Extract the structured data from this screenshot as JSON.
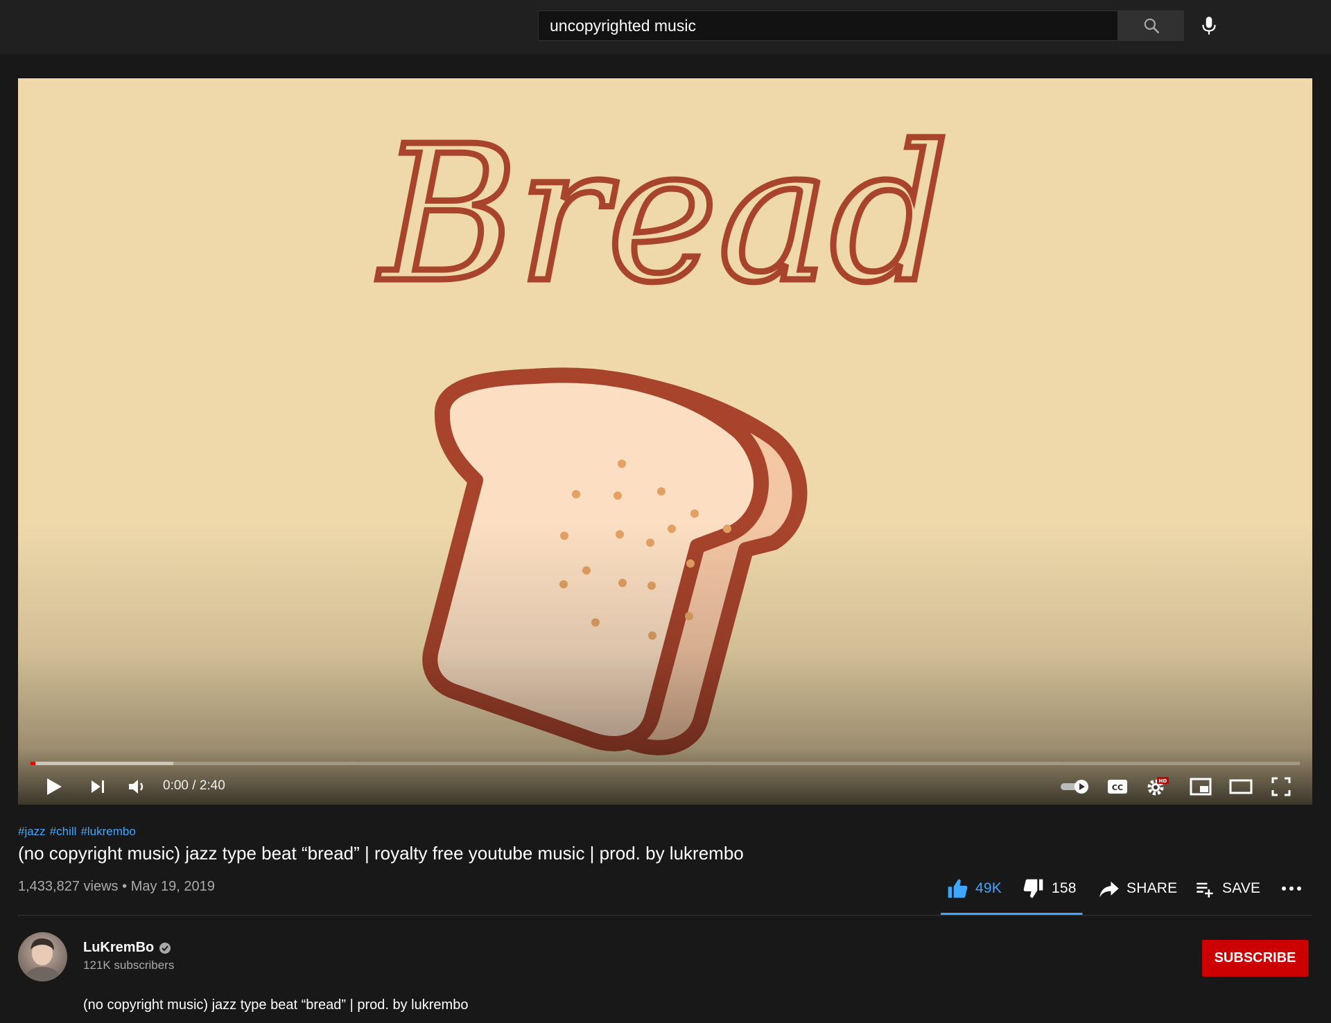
{
  "search": {
    "query": "uncopyrighted music",
    "search_icon": "search-icon",
    "mic_icon": "microphone-icon"
  },
  "player": {
    "thumbnail_text": "Bread",
    "time": "0:00 / 2:40",
    "progress": 0.0,
    "buffered": 0.11,
    "controls": [
      "play-icon",
      "next-icon",
      "volume-icon",
      "autoplay-toggle-icon",
      "captions-icon",
      "settings-icon",
      "miniplayer-icon",
      "theater-mode-icon",
      "fullscreen-icon"
    ],
    "hd_badge": "HD"
  },
  "video": {
    "hashtags": [
      "#jazz",
      "#chill",
      "#lukrembo"
    ],
    "title": "(no copyright music) jazz type beat “bread” | royalty free youtube music | prod. by lukrembo",
    "views": "1,433,827 views",
    "separator": "•",
    "date": "May 19, 2019"
  },
  "actions": {
    "likes": "49K",
    "dislikes": "158",
    "share_label": "SHARE",
    "save_label": "SAVE",
    "like_ratio": 0.997
  },
  "channel": {
    "name": "LuKremBo",
    "subscribers": "121K subscribers",
    "subscribe_label": "SUBSCRIBE",
    "description": "(no copyright music) jazz type beat “bread” | prod. by lukrembo"
  },
  "colors": {
    "accent_blue": "#3ea6ff",
    "subscribe_red": "#cc0000",
    "bread_outline": "#a8442c",
    "thumbnail_bg": "#efd9ab"
  }
}
